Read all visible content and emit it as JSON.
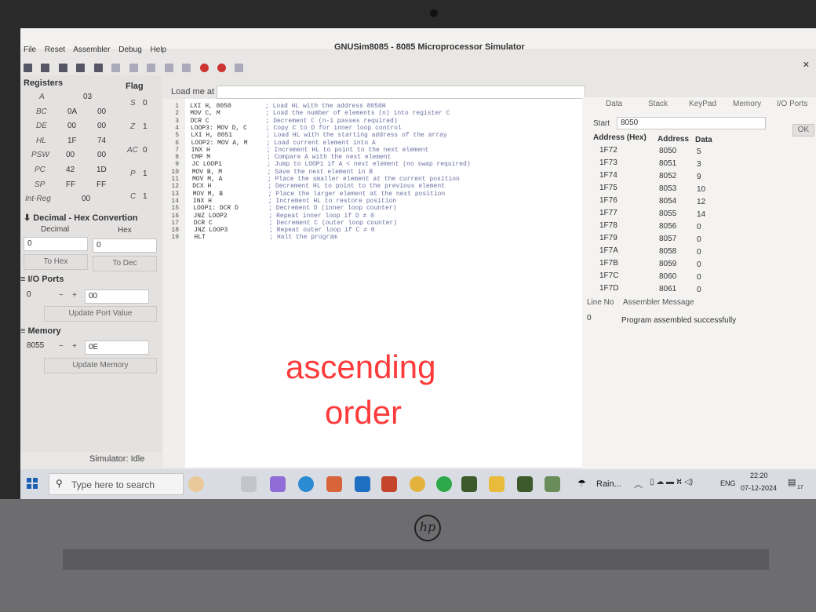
{
  "window": {
    "title": "GNUSim8085 - 8085 Microprocessor Simulator"
  },
  "menu": [
    "File",
    "Reset",
    "Assembler",
    "Debug",
    "Help"
  ],
  "registers": {
    "title": "Registers",
    "A": {
      "label": "A",
      "v1": "03"
    },
    "BC": {
      "label": "BC",
      "v1": "0A",
      "v2": "00"
    },
    "DE": {
      "label": "DE",
      "v1": "00",
      "v2": "00"
    },
    "HL": {
      "label": "HL",
      "v1": "1F",
      "v2": "74"
    },
    "PSW": {
      "label": "PSW",
      "v1": "00",
      "v2": "00"
    },
    "PC": {
      "label": "PC",
      "v1": "42",
      "v2": "1D"
    },
    "SP": {
      "label": "SP",
      "v1": "FF",
      "v2": "FF"
    },
    "IntReg": {
      "label": "Int-Reg",
      "v1": "00"
    }
  },
  "flags": {
    "title": "Flag",
    "items": [
      {
        "label": "S",
        "value": "0"
      },
      {
        "label": "Z",
        "value": "1"
      },
      {
        "label": "AC",
        "value": "0"
      },
      {
        "label": "P",
        "value": "1"
      },
      {
        "label": "C",
        "value": "1"
      }
    ]
  },
  "conversion": {
    "title": "Decimal - Hex Convertion",
    "decimal_label": "Decimal",
    "hex_label": "Hex",
    "decimal_value": "0",
    "hex_value": "0",
    "to_hex": "To Hex",
    "to_dec": "To Dec"
  },
  "io_ports": {
    "title": "I/O Ports",
    "port": "0",
    "minus": "−",
    "plus": "+",
    "value": "00",
    "update": "Update Port Value"
  },
  "memory": {
    "title": "Memory",
    "address": "8055",
    "minus": "−",
    "plus": "+",
    "value": "0E",
    "update": "Update Memory"
  },
  "editor": {
    "load_label": "Load me at",
    "lines": [
      {
        "n": "1",
        "code": "LXI H, 8050",
        "comment": "; Load HL with the address 8050H"
      },
      {
        "n": "2",
        "code": "MOV C, M",
        "comment": "; Load the number of elements (n) into register C"
      },
      {
        "n": "3",
        "code": "DCR C",
        "comment": "; Decrement C (n-1 passes required)"
      },
      {
        "n": "4",
        "code": "LOOP3: MOV D, C",
        "comment": "; Copy C to D for inner loop control"
      },
      {
        "n": "5",
        "code": "LXI H, 8051",
        "comment": "; Load HL with the starting address of the array"
      },
      {
        "n": "6",
        "code": "LOOP2: MOV A, M",
        "comment": "; Load current element into A"
      },
      {
        "n": "7",
        "code": "INX H",
        "comment": "; Increment HL to point to the next element"
      },
      {
        "n": "8",
        "code": "CMP M",
        "comment": "; Compare A with the next element"
      },
      {
        "n": "9",
        "code": "JC LOOP1",
        "comment": "; Jump to LOOP1 if A < next element (no swap required)"
      },
      {
        "n": "10",
        "code": "MOV B, M",
        "comment": "; Save the next element in B"
      },
      {
        "n": "11",
        "code": "MOV M, A",
        "comment": "; Place the smaller element at the current position"
      },
      {
        "n": "12",
        "code": "DCX H",
        "comment": "; Decrement HL to point to the previous element"
      },
      {
        "n": "13",
        "code": "MOV M, B",
        "comment": "; Place the larger element at the next position"
      },
      {
        "n": "14",
        "code": "INX H",
        "comment": "; Increment HL to restore position"
      },
      {
        "n": "15",
        "code": "LOOP1: DCR D",
        "comment": "; Decrement D (inner loop counter)"
      },
      {
        "n": "16",
        "code": "JNZ LOOP2",
        "comment": "; Repeat inner loop if D ≠ 0"
      },
      {
        "n": "17",
        "code": "DCR C",
        "comment": "; Decrement C (outer loop counter)"
      },
      {
        "n": "18",
        "code": "JNZ LOOP3",
        "comment": "; Repeat outer loop if C ≠ 0"
      },
      {
        "n": "19",
        "code": "HLT",
        "comment": "; Halt the program"
      }
    ]
  },
  "right_panel": {
    "tabs": [
      "Data",
      "Stack",
      "KeyPad",
      "Memory",
      "I/O Ports"
    ],
    "start_label": "Start",
    "start_value": "8050",
    "ok": "OK",
    "columns": [
      "Address (Hex)",
      "Address",
      "Data"
    ],
    "rows": [
      [
        "1F72",
        "8050",
        "5"
      ],
      [
        "1F73",
        "8051",
        "3"
      ],
      [
        "1F74",
        "8052",
        "9"
      ],
      [
        "1F75",
        "8053",
        "10"
      ],
      [
        "1F76",
        "8054",
        "12"
      ],
      [
        "1F77",
        "8055",
        "14"
      ],
      [
        "1F78",
        "8056",
        "0"
      ],
      [
        "1F79",
        "8057",
        "0"
      ],
      [
        "1F7A",
        "8058",
        "0"
      ],
      [
        "1F7B",
        "8059",
        "0"
      ],
      [
        "1F7C",
        "8060",
        "0"
      ],
      [
        "1F7D",
        "8061",
        "0"
      ]
    ],
    "msg_columns": [
      "Line No",
      "Assembler Message"
    ],
    "messages": [
      [
        "0",
        "Program assembled successfully"
      ]
    ]
  },
  "overlay": {
    "line1": "ascending",
    "line2": "order"
  },
  "status": "Simulator: Idle",
  "taskbar": {
    "search_placeholder": "Type here to search",
    "weather": "Rain...",
    "lang": "ENG",
    "time": "22:20",
    "date": "07-12-2024",
    "notif": "17"
  },
  "colors": {
    "overlay": "#ff3a3a",
    "accent_red": "#cc3333"
  }
}
